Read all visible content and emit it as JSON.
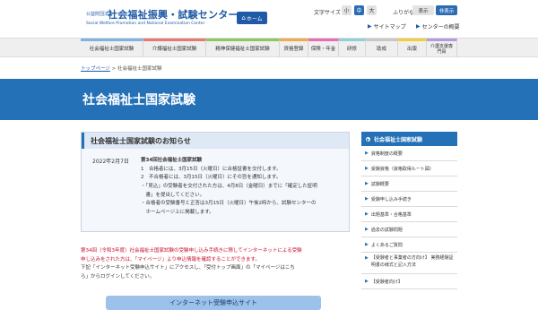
{
  "header": {
    "logo_sub": "公益財団法人",
    "logo_main": "社会福祉振興・試験センター",
    "logo_en": "Social Welfare Promotion and National Examination Center",
    "home_label": "ホーム",
    "font_size_label": "文字サイズ",
    "font_sizes": [
      "小",
      "中",
      "大"
    ],
    "ruby_label": "ふりがな",
    "ruby_off": "表示",
    "ruby_on": "非表示",
    "util_links": [
      "サイトマップ",
      "センターの概要"
    ]
  },
  "gnav": [
    {
      "label": "社会福祉士国家試験",
      "color": "#7fb2e2"
    },
    {
      "label": "介護福祉士国家試験",
      "color": "#e57a73"
    },
    {
      "label": "精神保健福祉士国家試験",
      "color": "#8cc95d"
    },
    {
      "label": "資格登録",
      "color": "#f0a94b"
    },
    {
      "label": "保険・年金",
      "color": "#e96cb5"
    },
    {
      "label": "研修",
      "color": "#8dd0d7"
    },
    {
      "label": "助成",
      "color": "#c7c7c7"
    },
    {
      "label": "出版",
      "color": "#f1cf3b"
    },
    {
      "label": "介護支援専門員",
      "color": "#b29be0"
    }
  ],
  "breadcrumb": {
    "home": "トップページ",
    "sep": ">",
    "current": "社会福祉士国家試験"
  },
  "banner_title": "社会福祉士国家試験",
  "news": {
    "title": "社会福祉士国家試験のお知らせ",
    "date": "2022年2月7日",
    "heading": "第34回社会福祉士国家試験",
    "lines": [
      "1　合格者には、3月15日（火曜日）に合格証書を交付します。",
      "2　不合格者には、3月15日（火曜日）にその旨を通知します。",
      "・「見込」の受験者を交付された方は、4月8日（金曜日）までに「確定した証明",
      "　書」を提出してください。",
      "・合格者の受験番号と正答は3月15日（火曜日）午後2時から、試験センターの",
      "　ホームページ上に掲載します。"
    ]
  },
  "notice": {
    "red_line1": "第34回（令和3年度）社会福祉士国家試験の受験申し込み手続きに際してインターネットによる受験",
    "red_line2": "申し込みをされた方は、「マイページ」より申込情報を確認することができます。",
    "black_line1": "下記「インターネット受験申込サイト」にアクセスし、「受付トップ画面」の「マイページはこち",
    "black_line2": "ら」からログインしてください。"
  },
  "cta_label": "インターネット受験申込サイト",
  "side": {
    "head": "社会福祉士国家試験",
    "items": [
      "資格制度の概要",
      "受験資格（資格取得ルート図）",
      "試験概要",
      "受験申し込み手続き",
      "出題基準・合格基準",
      "過去の試験問題",
      "よくあるご質問",
      "【受験者と事業者の方向け】 実務経験証明書の様式と記入方法",
      "【受験者向け】"
    ]
  }
}
